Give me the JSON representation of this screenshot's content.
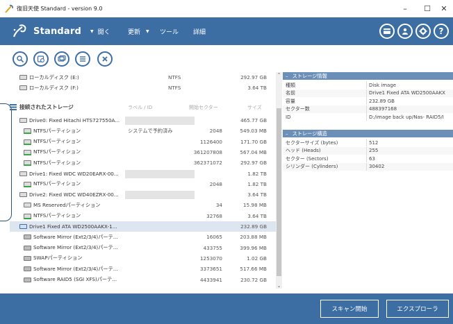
{
  "window": {
    "title": "復旧天使 Standard - version 9.0",
    "controls": {
      "minimize": "–",
      "maximize": "☐",
      "close": "✕"
    }
  },
  "header": {
    "brand": "Standard",
    "menu": [
      {
        "label": "開く"
      },
      {
        "label": "更新"
      },
      {
        "label": "ツール"
      },
      {
        "label": "詳細"
      }
    ],
    "right_buttons": [
      "card-icon",
      "user-icon",
      "gear-icon",
      "help-icon"
    ],
    "help_label": "?"
  },
  "toolbar": [
    "search-icon",
    "disk-scan-icon",
    "image-icon",
    "list-icon",
    "close-circle-icon"
  ],
  "list": {
    "top_rows": [
      {
        "name": "ローカルディスク (E:)",
        "fs": "NTFS",
        "size": "292.97 GB"
      },
      {
        "name": "ローカルディスク (F:)",
        "fs": "NTFS",
        "size": "3.64 TB"
      }
    ],
    "section_title": "接続されたストレージ",
    "columns": {
      "label": "ラベル / ID",
      "start": "開始セクター",
      "size": "サイズ"
    },
    "rows": [
      {
        "type": "drive",
        "name": "Drive0: Fixed Hitachi HTS727550A...",
        "label": "",
        "start": "",
        "size": "465.77 GB",
        "gray": true
      },
      {
        "type": "part",
        "name": "NTFSパーティション",
        "label": "システムで予約済み",
        "start": "2048",
        "size": "549.03 MB"
      },
      {
        "type": "part",
        "name": "NTFSパーティション",
        "label": "",
        "start": "1126400",
        "size": "171.70 GB"
      },
      {
        "type": "part",
        "name": "NTFSパーティション",
        "label": "",
        "start": "361207808",
        "size": "567.04 MB"
      },
      {
        "type": "part",
        "name": "NTFSパーティション",
        "label": "",
        "start": "362371072",
        "size": "292.97 GB"
      },
      {
        "type": "drive",
        "name": "Drive1: Fixed WDC WD20EARX-00...",
        "label": "",
        "start": "",
        "size": "1.82 TB",
        "gray": true
      },
      {
        "type": "part",
        "name": "NTFSパーティション",
        "label": "",
        "start": "2048",
        "size": "1.82 TB"
      },
      {
        "type": "drive",
        "name": "Drive2: Fixed WDC WD40EZRX-00...",
        "label": "",
        "start": "",
        "size": "3.64 TB",
        "gray": true
      },
      {
        "type": "part-gray",
        "name": "MS Reservedパーティション",
        "label": "",
        "start": "34",
        "size": "15.98 MB"
      },
      {
        "type": "part",
        "name": "NTFSパーティション",
        "label": "",
        "start": "32768",
        "size": "3.64 TB"
      },
      {
        "type": "image",
        "name": "Drive1 Fixed ATA WD2500AAKX-1...",
        "label": "",
        "start": "",
        "size": "232.89 GB",
        "selected": true
      },
      {
        "type": "hd",
        "name": "Software Mirror (Ext2/3/4)パーテ...",
        "label": "",
        "start": "16065",
        "size": "203.88 MB"
      },
      {
        "type": "hd",
        "name": "Software Mirror (Ext2/3/4)パーテ...",
        "label": "",
        "start": "433755",
        "size": "399.96 MB"
      },
      {
        "type": "hd",
        "name": "SWAPパーティション",
        "label": "",
        "start": "1253070",
        "size": "1.02 GB"
      },
      {
        "type": "hd",
        "name": "Software Mirror (Ext2/3/4)パーテ...",
        "label": "",
        "start": "3373651",
        "size": "517.66 MB"
      },
      {
        "type": "hd",
        "name": "Software RAID5 (SGI XFS)パーテ...",
        "label": "",
        "start": "4433941",
        "size": "230.72 GB"
      }
    ]
  },
  "panel": {
    "info_title": "ストレージ情報",
    "info": [
      {
        "k": "種類",
        "v": "Disk image"
      },
      {
        "k": "名前",
        "v": "Drive1 Fixed ATA WD2500AAKX"
      },
      {
        "k": "容量",
        "v": "232.89 GB"
      },
      {
        "k": "セクター数",
        "v": "488397168"
      },
      {
        "k": "ID",
        "v": "D:/image back up/Nas- RAID5/I"
      }
    ],
    "struct_title": "ストレージ構造",
    "struct": [
      {
        "k": "セクターサイズ (bytes)",
        "v": "512"
      },
      {
        "k": "ヘッド (Heads)",
        "v": "255"
      },
      {
        "k": "セクター (Sectors)",
        "v": "63"
      },
      {
        "k": "シリンダー (Cylinders)",
        "v": "30402"
      }
    ]
  },
  "footer": {
    "scan_button": "スキャン開始",
    "explorer_button": "エクスプローラ"
  },
  "colors": {
    "brand_blue": "#3c6ea4",
    "panel_header": "#6c8fb8",
    "green": "#3aa44a"
  }
}
